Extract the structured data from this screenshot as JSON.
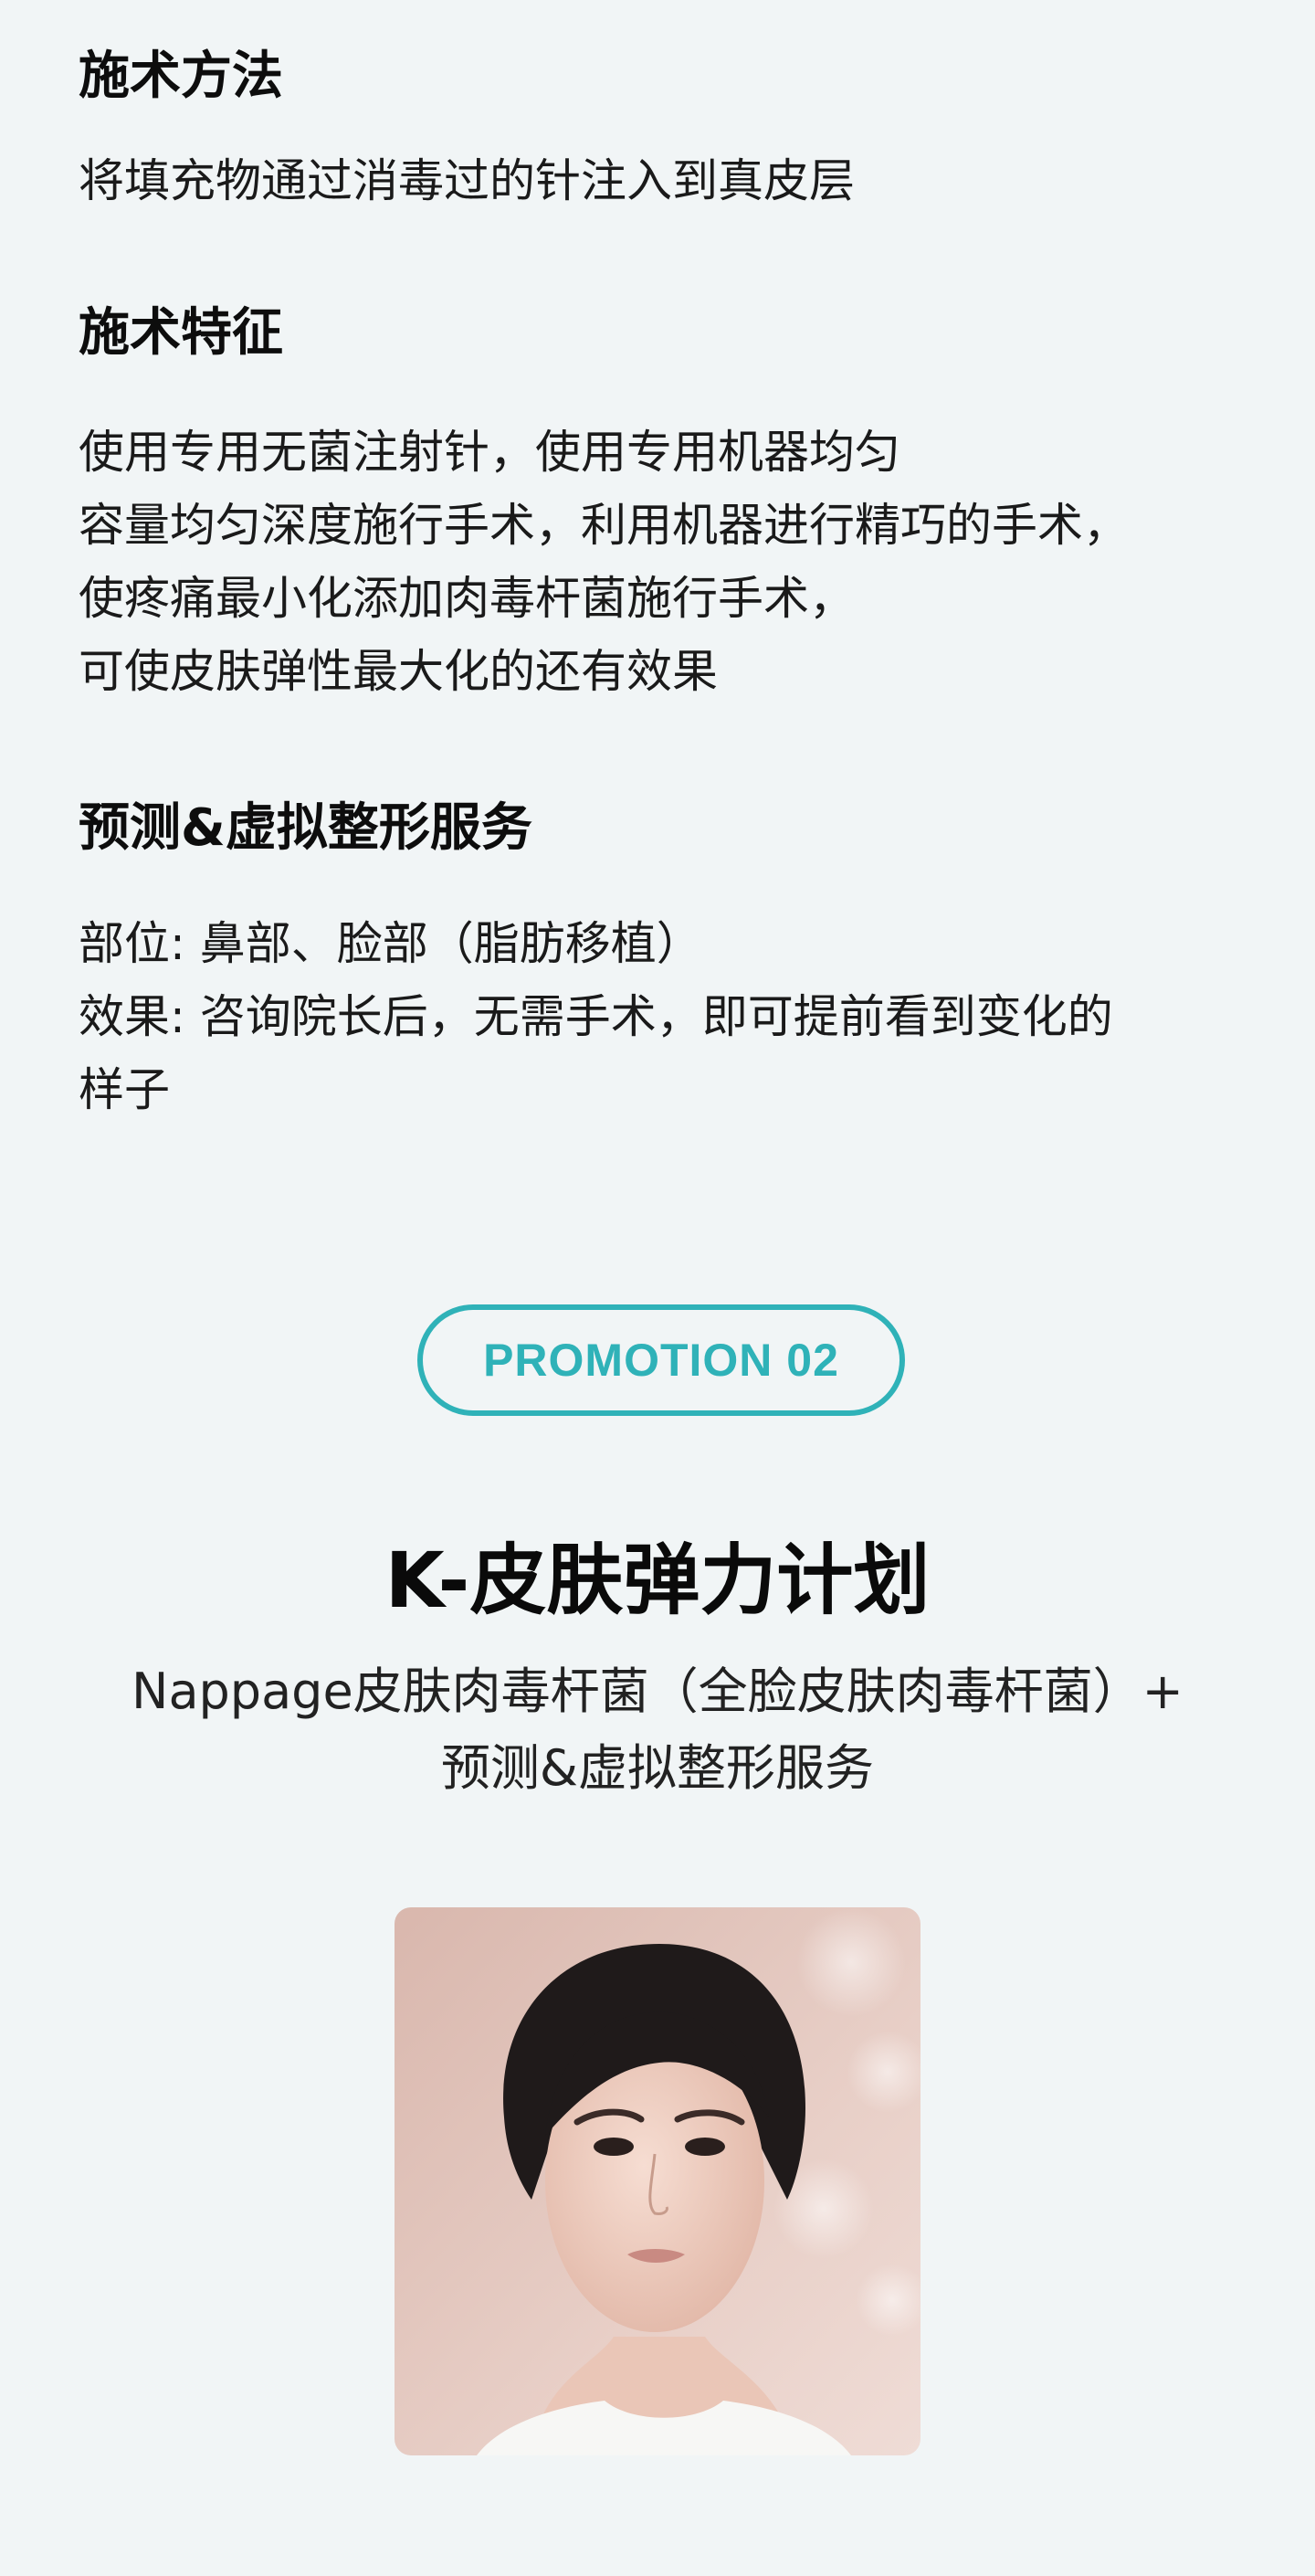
{
  "sections": [
    {
      "id": "method",
      "title": "施术方法",
      "lines": [
        "将填充物通过消毒过的针注入到真皮层"
      ]
    },
    {
      "id": "feature",
      "title": "施术特征",
      "lines": [
        "使用专用无菌注射针，使用专用机器均匀",
        "容量均匀深度施行手术，利用机器进行精巧的手术，",
        "使疼痛最小化添加肉毒杆菌施行手术，",
        "可使皮肤弹性最大化的还有效果"
      ]
    },
    {
      "id": "virtual",
      "title": "预测&虚拟整形服务",
      "lines": [
        "部位: 鼻部、脸部（脂肪移植）",
        "效果: 咨询院长后，无需手术，即可提前看到变化的",
        "样子"
      ]
    }
  ],
  "promotion": {
    "badge": "PROMOTION 02",
    "title": "K-皮肤弹力计划",
    "subtitle_lines": [
      "Nappage皮肤肉毒杆菌（全脸皮肤肉毒杆菌）+",
      "预测&虚拟整形服务"
    ]
  },
  "colors": {
    "accent": "#2fb2b8",
    "background": "#f1f5f6"
  }
}
